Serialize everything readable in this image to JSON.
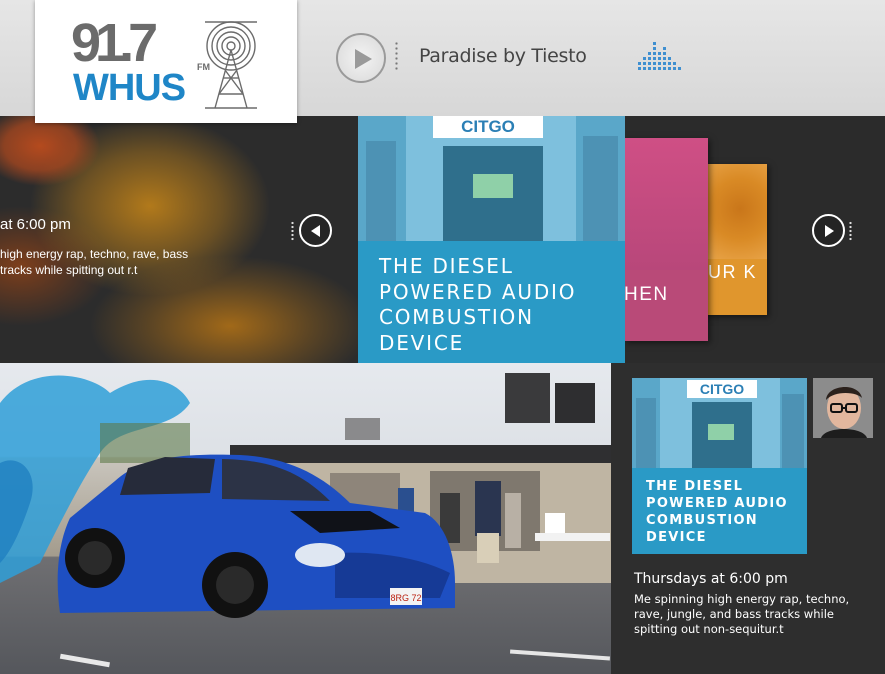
{
  "header": {
    "logo": {
      "frequency": "91.7",
      "fm": "FM",
      "callsign": "WHUS"
    },
    "now_playing": "Paradise by Tiesto"
  },
  "carousel": {
    "left_panel": {
      "time": "at 6:00 pm",
      "description": "high energy rap, techno, rave, bass tracks while spitting out r.t"
    },
    "cards": [
      {
        "label": "THE DIESEL POWERED AUDIO COMBUSTION DEVICE",
        "sign": "CITGO",
        "color": "#2a9ac6"
      },
      {
        "label": "HEN",
        "color": "#b94a78"
      },
      {
        "label": "UR K",
        "color": "#e0962d"
      }
    ]
  },
  "featured_show": {
    "title": "THE DIESEL POWERED AUDIO COMBUSTION DEVICE",
    "sign": "CITGO",
    "time": "Thursdays at 6:00 pm",
    "description": "Me spinning high energy rap, techno, rave, jungle, and bass tracks while spitting out non-sequitur.t",
    "license_plate": "8RG 72"
  },
  "colors": {
    "accent": "#2a9ac6",
    "brand_blue": "#1f86c7",
    "pink": "#b94a78",
    "orange": "#e0962d"
  }
}
